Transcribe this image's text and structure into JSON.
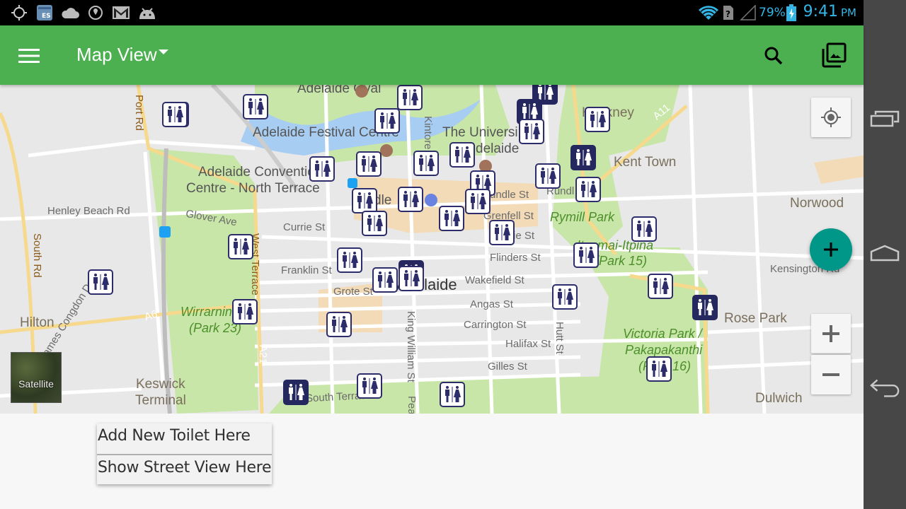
{
  "status_bar": {
    "left_icons": [
      "location-target-icon",
      "es-file-explorer-icon",
      "cloud-icon",
      "vpn-shield-icon",
      "gmail-icon",
      "android-debug-icon"
    ],
    "right_icons": [
      "wifi-icon",
      "no-sim-icon",
      "signal-icon",
      "battery-charging-icon"
    ],
    "battery_percent": "79%",
    "time": "9:41",
    "ampm": "PM",
    "accent_color": "#33b5e5"
  },
  "app_bar": {
    "title": "Map View",
    "menu_icon": "hamburger-menu-icon",
    "search_icon": "search-icon",
    "gallery_icon": "photo-library-icon",
    "color": "#4caf50"
  },
  "map": {
    "labels": {
      "adelaide_oval": "Adelaide Oval",
      "festival_centre": "Adelaide Festival Centre",
      "university_1": "The Universi",
      "university_2": "delaide",
      "hackney": "Hackney",
      "kent_town": "Kent Town",
      "norwood": "Norwood",
      "convention_1": "Adelaide Conventio",
      "convention_2": "Centre - North Terrace",
      "henley": "Henley Beach Rd",
      "glover": "Glover Ave",
      "currie": "Currie St",
      "rundle_mall": "dle",
      "rundle_st": "undle St",
      "rundle": "Rundl",
      "grenfell": "Grenfell St",
      "pirie": "ie St",
      "rymill": "Rymill Park",
      "ityamai_1": "Ityamai-Itpina",
      "ityamai_2": "(Park 15)",
      "flinders": "Flinders St",
      "franklin": "Franklin St",
      "wakefield": "Wakefield St",
      "grote": "Grote St",
      "adelaide_city": "Adelaide",
      "kensington": "Kensington Rd",
      "angas": "Angas St",
      "carrington": "Carrington St",
      "halifax": "Halifax St",
      "gilles": "Gilles St",
      "hutt": "Hutt St",
      "king_william": "King William St",
      "pea": "Pea",
      "kintore": "Kintore",
      "south_terrace": "South Terrace",
      "wirranendi_1": "Wirrarnin",
      "wirranendi_2": "(Park 23)",
      "west_terrace": "West Terrace",
      "south_rd": "South Rd",
      "port_rd": "Port Rd",
      "hilton": "Hilton",
      "rose_park": "Rose Park",
      "victoria_1": "Victoria Park /",
      "victoria_2": "Pakapakanthi",
      "victoria_3": "(Park 16)",
      "keswick_1": "Keswick",
      "keswick_2": "Terminal",
      "james_congdon": "James Congdon Dr",
      "dulwich": "Dulwich",
      "a11": "A11",
      "a6": "A6",
      "a21": "A21"
    },
    "toilet_marker_count": 40,
    "satellite_label": "Satellite",
    "controls": {
      "my_location_icon": "my-location-icon",
      "zoom_in_icon": "plus-icon",
      "zoom_out_icon": "minus-icon",
      "fab_icon": "add-icon",
      "fab_color": "#009688"
    }
  },
  "context_menu": {
    "items": [
      {
        "label": "Add New Toilet Here"
      },
      {
        "label": "Show Street View Here"
      }
    ]
  },
  "nav_bar": {
    "recents_icon": "recent-apps-icon",
    "home_icon": "home-icon",
    "back_icon": "back-icon"
  }
}
